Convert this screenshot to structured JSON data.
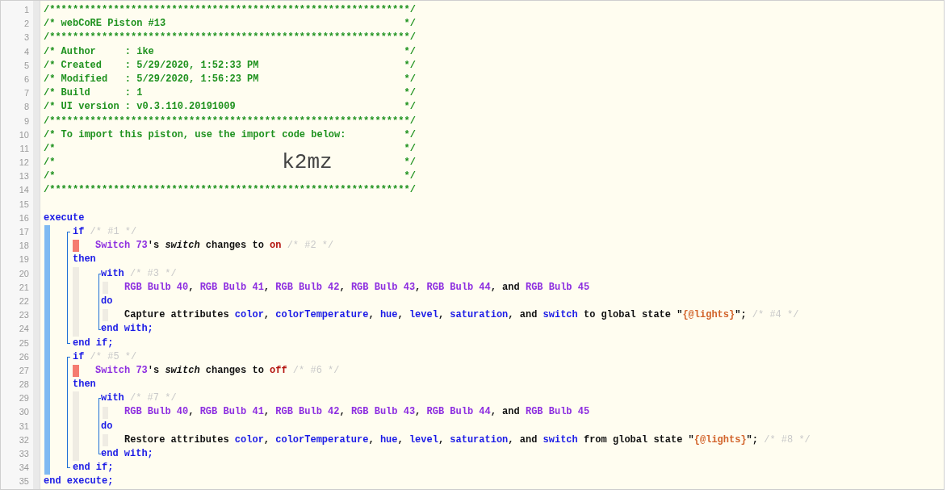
{
  "editor": {
    "header": [
      {
        "number": "1",
        "tokens": [
          {
            "kind": "comment",
            "text": "/**************************************************************/"
          }
        ]
      },
      {
        "number": "2",
        "tokens": [
          {
            "kind": "comment",
            "text": "/* webCoRE Piston #13"
          },
          {
            "kind": "comment",
            "text": "*/"
          }
        ]
      },
      {
        "number": "3",
        "tokens": [
          {
            "kind": "comment",
            "text": "/**************************************************************/"
          }
        ]
      },
      {
        "number": "4",
        "tokens": [
          {
            "kind": "comment",
            "text": "/* Author     : ike"
          },
          {
            "kind": "comment",
            "text": "*/"
          }
        ]
      },
      {
        "number": "5",
        "tokens": [
          {
            "kind": "comment",
            "text": "/* Created    : 5/29/2020, 1:52:33 PM"
          },
          {
            "kind": "comment",
            "text": "*/"
          }
        ]
      },
      {
        "number": "6",
        "tokens": [
          {
            "kind": "comment",
            "text": "/* Modified   : 5/29/2020, 1:56:23 PM"
          },
          {
            "kind": "comment",
            "text": "*/"
          }
        ]
      },
      {
        "number": "7",
        "tokens": [
          {
            "kind": "comment",
            "text": "/* Build      : 1"
          },
          {
            "kind": "comment",
            "text": "*/"
          }
        ]
      },
      {
        "number": "8",
        "tokens": [
          {
            "kind": "comment",
            "text": "/* UI version : v0.3.110.20191009"
          },
          {
            "kind": "comment",
            "text": "*/"
          }
        ]
      },
      {
        "number": "9",
        "tokens": [
          {
            "kind": "comment",
            "text": "/**************************************************************/"
          }
        ]
      },
      {
        "number": "10",
        "tokens": [
          {
            "kind": "comment",
            "text": "/* To import this piston, use the import code below:"
          },
          {
            "kind": "comment",
            "text": "*/"
          }
        ]
      },
      {
        "number": "11",
        "tokens": [
          {
            "kind": "comment",
            "text": "/*"
          },
          {
            "kind": "comment",
            "text": "*/"
          }
        ]
      },
      {
        "number": "12",
        "tokens": [
          {
            "kind": "comment",
            "text": "/*"
          },
          {
            "kind": "code",
            "text": "k2mz"
          },
          {
            "kind": "comment",
            "text": "*/"
          }
        ]
      },
      {
        "number": "13",
        "tokens": [
          {
            "kind": "comment",
            "text": "/*"
          },
          {
            "kind": "comment",
            "text": "*/"
          }
        ]
      },
      {
        "number": "14",
        "tokens": [
          {
            "kind": "comment",
            "text": "/**************************************************************/"
          }
        ]
      }
    ],
    "blank_line": {
      "number": "15"
    },
    "program": {
      "kind": "execute",
      "rows": [
        {
          "kind": "line",
          "number": "16",
          "tokens": [
            {
              "kind": "keyword",
              "text": "execute"
            }
          ]
        },
        {
          "kind": "body",
          "children": [
            {
              "kind": "if",
              "rows": [
                {
                  "kind": "line",
                  "number": "17",
                  "tokens": [
                    {
                      "kind": "keyword",
                      "text": "if"
                    },
                    {
                      "kind": "note",
                      "text": "/* #1 */"
                    }
                  ]
                },
                {
                  "kind": "condition",
                  "number": "18",
                  "tokens": [
                    {
                      "kind": "device",
                      "text": "Switch 73"
                    },
                    {
                      "kind": "plain",
                      "text": "'s "
                    },
                    {
                      "kind": "attribute",
                      "text": "switch"
                    },
                    {
                      "kind": "plain",
                      "text": " changes to "
                    },
                    {
                      "kind": "value",
                      "text": "on"
                    },
                    {
                      "kind": "note",
                      "text": "/* #2 */"
                    }
                  ]
                },
                {
                  "kind": "line",
                  "number": "19",
                  "tokens": [
                    {
                      "kind": "keyword",
                      "text": "then"
                    }
                  ]
                },
                {
                  "kind": "body",
                  "children": [
                    {
                      "kind": "with",
                      "rows": [
                        {
                          "kind": "line",
                          "number": "20",
                          "tokens": [
                            {
                              "kind": "keyword",
                              "text": "with"
                            },
                            {
                              "kind": "note",
                              "text": "/* #3 */"
                            }
                          ]
                        },
                        {
                          "kind": "item",
                          "number": "21",
                          "tokens": [
                            {
                              "kind": "device",
                              "text": "RGB Bulb 40"
                            },
                            {
                              "kind": "plain",
                              "text": ", "
                            },
                            {
                              "kind": "device",
                              "text": "RGB Bulb 41"
                            },
                            {
                              "kind": "plain",
                              "text": ", "
                            },
                            {
                              "kind": "device",
                              "text": "RGB Bulb 42"
                            },
                            {
                              "kind": "plain",
                              "text": ", "
                            },
                            {
                              "kind": "device",
                              "text": "RGB Bulb 43"
                            },
                            {
                              "kind": "plain",
                              "text": ", "
                            },
                            {
                              "kind": "device",
                              "text": "RGB Bulb 44"
                            },
                            {
                              "kind": "plain",
                              "text": ", and "
                            },
                            {
                              "kind": "device",
                              "text": "RGB Bulb 45"
                            }
                          ]
                        },
                        {
                          "kind": "line",
                          "number": "22",
                          "tokens": [
                            {
                              "kind": "keyword",
                              "text": "do"
                            }
                          ]
                        },
                        {
                          "kind": "item",
                          "number": "23",
                          "tokens": [
                            {
                              "kind": "plain",
                              "text": "Capture attributes "
                            },
                            {
                              "kind": "property",
                              "text": "color"
                            },
                            {
                              "kind": "plain",
                              "text": ", "
                            },
                            {
                              "kind": "property",
                              "text": "colorTemperature"
                            },
                            {
                              "kind": "plain",
                              "text": ", "
                            },
                            {
                              "kind": "property",
                              "text": "hue"
                            },
                            {
                              "kind": "plain",
                              "text": ", "
                            },
                            {
                              "kind": "property",
                              "text": "level"
                            },
                            {
                              "kind": "plain",
                              "text": ", "
                            },
                            {
                              "kind": "property",
                              "text": "saturation"
                            },
                            {
                              "kind": "plain",
                              "text": ", and "
                            },
                            {
                              "kind": "property",
                              "text": "switch"
                            },
                            {
                              "kind": "plain",
                              "text": " to global state \""
                            },
                            {
                              "kind": "string",
                              "text": "{@lights}"
                            },
                            {
                              "kind": "plain",
                              "text": "\";"
                            },
                            {
                              "kind": "note",
                              "text": "/* #4 */"
                            }
                          ]
                        },
                        {
                          "kind": "line",
                          "number": "24",
                          "tokens": [
                            {
                              "kind": "keyword",
                              "text": "end with;"
                            }
                          ]
                        }
                      ]
                    }
                  ]
                },
                {
                  "kind": "line",
                  "number": "25",
                  "tokens": [
                    {
                      "kind": "keyword",
                      "text": "end if;"
                    }
                  ]
                }
              ]
            },
            {
              "kind": "if",
              "rows": [
                {
                  "kind": "line",
                  "number": "26",
                  "tokens": [
                    {
                      "kind": "keyword",
                      "text": "if"
                    },
                    {
                      "kind": "note",
                      "text": "/* #5 */"
                    }
                  ]
                },
                {
                  "kind": "condition",
                  "number": "27",
                  "tokens": [
                    {
                      "kind": "device",
                      "text": "Switch 73"
                    },
                    {
                      "kind": "plain",
                      "text": "'s "
                    },
                    {
                      "kind": "attribute",
                      "text": "switch"
                    },
                    {
                      "kind": "plain",
                      "text": " changes to "
                    },
                    {
                      "kind": "value",
                      "text": "off"
                    },
                    {
                      "kind": "note",
                      "text": "/* #6 */"
                    }
                  ]
                },
                {
                  "kind": "line",
                  "number": "28",
                  "tokens": [
                    {
                      "kind": "keyword",
                      "text": "then"
                    }
                  ]
                },
                {
                  "kind": "body",
                  "children": [
                    {
                      "kind": "with",
                      "rows": [
                        {
                          "kind": "line",
                          "number": "29",
                          "tokens": [
                            {
                              "kind": "keyword",
                              "text": "with"
                            },
                            {
                              "kind": "note",
                              "text": "/* #7 */"
                            }
                          ]
                        },
                        {
                          "kind": "item",
                          "number": "30",
                          "tokens": [
                            {
                              "kind": "device",
                              "text": "RGB Bulb 40"
                            },
                            {
                              "kind": "plain",
                              "text": ", "
                            },
                            {
                              "kind": "device",
                              "text": "RGB Bulb 41"
                            },
                            {
                              "kind": "plain",
                              "text": ", "
                            },
                            {
                              "kind": "device",
                              "text": "RGB Bulb 42"
                            },
                            {
                              "kind": "plain",
                              "text": ", "
                            },
                            {
                              "kind": "device",
                              "text": "RGB Bulb 43"
                            },
                            {
                              "kind": "plain",
                              "text": ", "
                            },
                            {
                              "kind": "device",
                              "text": "RGB Bulb 44"
                            },
                            {
                              "kind": "plain",
                              "text": ", and "
                            },
                            {
                              "kind": "device",
                              "text": "RGB Bulb 45"
                            }
                          ]
                        },
                        {
                          "kind": "line",
                          "number": "31",
                          "tokens": [
                            {
                              "kind": "keyword",
                              "text": "do"
                            }
                          ]
                        },
                        {
                          "kind": "item",
                          "number": "32",
                          "tokens": [
                            {
                              "kind": "plain",
                              "text": "Restore attributes "
                            },
                            {
                              "kind": "property",
                              "text": "color"
                            },
                            {
                              "kind": "plain",
                              "text": ", "
                            },
                            {
                              "kind": "property",
                              "text": "colorTemperature"
                            },
                            {
                              "kind": "plain",
                              "text": ", "
                            },
                            {
                              "kind": "property",
                              "text": "hue"
                            },
                            {
                              "kind": "plain",
                              "text": ", "
                            },
                            {
                              "kind": "property",
                              "text": "level"
                            },
                            {
                              "kind": "plain",
                              "text": ", "
                            },
                            {
                              "kind": "property",
                              "text": "saturation"
                            },
                            {
                              "kind": "plain",
                              "text": ", and "
                            },
                            {
                              "kind": "property",
                              "text": "switch"
                            },
                            {
                              "kind": "plain",
                              "text": " from global state \""
                            },
                            {
                              "kind": "string",
                              "text": "{@lights}"
                            },
                            {
                              "kind": "plain",
                              "text": "\";"
                            },
                            {
                              "kind": "note",
                              "text": "/* #8 */"
                            }
                          ]
                        },
                        {
                          "kind": "line",
                          "number": "33",
                          "tokens": [
                            {
                              "kind": "keyword",
                              "text": "end with;"
                            }
                          ]
                        }
                      ]
                    }
                  ]
                },
                {
                  "kind": "line",
                  "number": "34",
                  "tokens": [
                    {
                      "kind": "keyword",
                      "text": "end if;"
                    }
                  ]
                }
              ]
            }
          ]
        },
        {
          "kind": "line",
          "number": "35",
          "tokens": [
            {
              "kind": "keyword",
              "text": "end execute;"
            }
          ]
        }
      ]
    }
  }
}
